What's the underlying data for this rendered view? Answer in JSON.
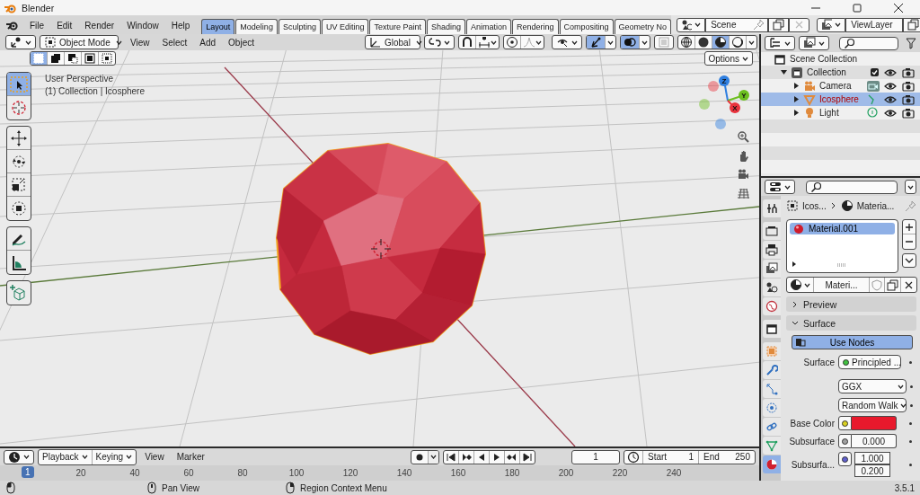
{
  "window": {
    "title": "Blender"
  },
  "menu": [
    "File",
    "Edit",
    "Render",
    "Window",
    "Help"
  ],
  "workspaces": [
    {
      "label": "Layout",
      "selected": true
    },
    {
      "label": "Modeling",
      "selected": false
    },
    {
      "label": "Sculpting",
      "selected": false
    },
    {
      "label": "UV Editing",
      "selected": false
    },
    {
      "label": "Texture Paint",
      "selected": false
    },
    {
      "label": "Shading",
      "selected": false
    },
    {
      "label": "Animation",
      "selected": false
    },
    {
      "label": "Rendering",
      "selected": false
    },
    {
      "label": "Compositing",
      "selected": false
    },
    {
      "label": "Geometry No",
      "selected": false
    }
  ],
  "scene": {
    "value": "Scene"
  },
  "view_layer": {
    "value": "ViewLayer"
  },
  "viewport": {
    "mode": "Object Mode",
    "menus": [
      "View",
      "Select",
      "Add",
      "Object"
    ],
    "orientation": "Global",
    "toggles": [
      {
        "kind": "gizmo",
        "on": true
      },
      {
        "kind": "overlay",
        "on": true
      },
      {
        "kind": "xray",
        "on": false
      }
    ],
    "shading": [
      {
        "kind": "wireframe",
        "selected": false
      },
      {
        "kind": "solid",
        "selected": false
      },
      {
        "kind": "material",
        "selected": true
      },
      {
        "kind": "rendered",
        "selected": false
      }
    ],
    "select_modes": [
      {
        "kind": "set",
        "selected": true
      },
      {
        "kind": "extend",
        "selected": false
      },
      {
        "kind": "subtract",
        "selected": false
      },
      {
        "kind": "invert",
        "selected": false
      },
      {
        "kind": "intersect",
        "selected": false
      }
    ],
    "options": "Options",
    "overlay_text": [
      "User Perspective",
      "(1) Collection | Icosphere"
    ],
    "tool_groups": [
      {
        "tools": [
          {
            "kind": "select",
            "selected": true
          },
          {
            "kind": "cursor",
            "selected": false
          }
        ]
      },
      {
        "tools": [
          {
            "kind": "move",
            "selected": false
          },
          {
            "kind": "rotate",
            "selected": false
          },
          {
            "kind": "scale",
            "selected": false
          },
          {
            "kind": "transform",
            "selected": false
          }
        ]
      },
      {
        "tools": [
          {
            "kind": "annotate",
            "selected": false
          },
          {
            "kind": "measure",
            "selected": false
          }
        ]
      },
      {
        "tools": [
          {
            "kind": "add-cube",
            "selected": false
          }
        ]
      }
    ],
    "gizmo": {
      "axes": [
        {
          "label": "Z",
          "color": "#2f7fe0"
        },
        {
          "label": "Y",
          "color": "#6cbf1f"
        },
        {
          "label": "X",
          "color": "#e8323c"
        }
      ]
    }
  },
  "outliner": {
    "scene_collection": "Scene Collection",
    "collections": [
      {
        "label": "Collection",
        "expanded": true,
        "checked": true,
        "children": [
          {
            "label": "Camera",
            "kind": "camera",
            "expanded": false,
            "selected": false
          },
          {
            "label": "Icosphere",
            "kind": "mesh",
            "expanded": false,
            "selected": true
          },
          {
            "label": "Light",
            "kind": "light",
            "expanded": false,
            "selected": false
          }
        ]
      }
    ]
  },
  "properties": {
    "tabs": [
      {
        "kind": "tool",
        "selected": false
      },
      {
        "kind": "render",
        "selected": false
      },
      {
        "kind": "output",
        "selected": false
      },
      {
        "kind": "view-layer",
        "selected": false
      },
      {
        "kind": "scene",
        "selected": false
      },
      {
        "kind": "world",
        "selected": false
      },
      {
        "kind": "collection",
        "selected": false
      },
      {
        "kind": "object",
        "selected": false
      },
      {
        "kind": "modifiers",
        "selected": false
      },
      {
        "kind": "particles",
        "selected": false
      },
      {
        "kind": "physics",
        "selected": false
      },
      {
        "kind": "constraints",
        "selected": false
      },
      {
        "kind": "data",
        "selected": false
      },
      {
        "kind": "material",
        "selected": true
      }
    ],
    "breadcrumb": [
      {
        "kind": "object",
        "label": "Icos..."
      },
      {
        "kind": "material",
        "label": "Materia..."
      }
    ],
    "material_slots": [
      {
        "name": "Material.001",
        "selected": true
      }
    ],
    "material_name": "Materi...",
    "panels": [
      {
        "label": "Preview",
        "expanded": false
      },
      {
        "label": "Surface",
        "expanded": true
      }
    ],
    "use_nodes": {
      "label": "Use Nodes",
      "on": true
    },
    "fields": [
      {
        "kind": "shader",
        "label": "Surface",
        "value": "Principled ..."
      },
      {
        "kind": "dropdown",
        "value": "GGX"
      },
      {
        "kind": "dropdown",
        "value": "Random Walk"
      },
      {
        "kind": "color",
        "label": "Base Color",
        "color": "#e8192c"
      },
      {
        "kind": "number",
        "label": "Subsurface",
        "value": "0.000"
      },
      {
        "kind": "vector",
        "label": "Subsurfa...",
        "values": [
          "1.000",
          "0.200"
        ]
      }
    ]
  },
  "timeline": {
    "menus": [
      {
        "kind": "dropdown",
        "label": "Playback"
      },
      {
        "kind": "dropdown",
        "label": "Keying"
      },
      {
        "kind": "menu",
        "label": "View"
      },
      {
        "kind": "menu",
        "label": "Marker"
      }
    ],
    "current_frame": "1",
    "preview_range": {
      "on": false
    },
    "start": {
      "label": "Start",
      "value": "1"
    },
    "end": {
      "label": "End",
      "value": "250"
    },
    "ruler": {
      "current": "1",
      "ticks": [
        "20",
        "40",
        "60",
        "80",
        "100",
        "120",
        "140",
        "160",
        "180",
        "200",
        "220",
        "240"
      ]
    }
  },
  "status_bar": {
    "items": [
      {
        "kind": "mouse-left"
      },
      {
        "kind": "mouse-middle",
        "label": "Pan View"
      },
      {
        "kind": "mouse-right",
        "label": "Region Context Menu"
      }
    ],
    "version": "3.5.1"
  }
}
